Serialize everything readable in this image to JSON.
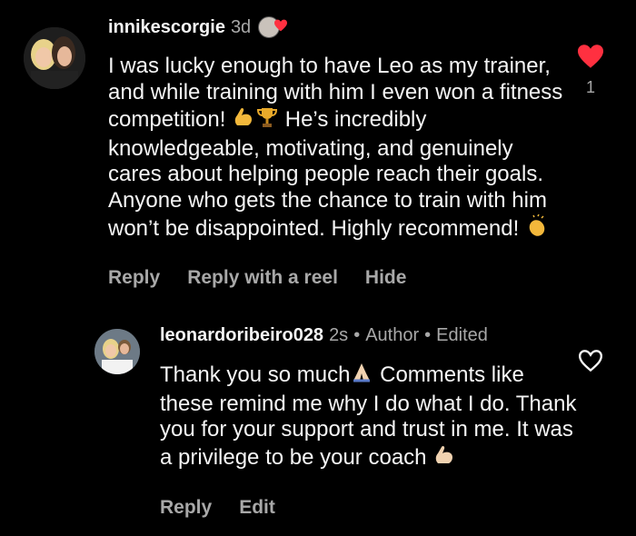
{
  "comments": [
    {
      "username": "innikescorgie",
      "time": "3d",
      "text_parts": [
        "I was lucky enough to have Leo as my trainer, and while training with him I even won a fitness competition! ",
        " He’s incredibly knowledgeable, motivating, and genuinely cares about helping people reach their goals. Anyone who gets the chance to train with him won’t be disappointed. Highly recommend! "
      ],
      "emojis": [
        "flexed-biceps",
        "trophy",
        "clapping-hands"
      ],
      "actions": [
        "Reply",
        "Reply with a reel",
        "Hide"
      ],
      "liked": true,
      "like_count": "1",
      "author_liked": true
    },
    {
      "username": "leonardoribeiro028",
      "time": "2s",
      "author_label": "Author",
      "edited_label": "Edited",
      "text_parts": [
        "Thank you so much",
        " Comments like these remind me why I do what I do. Thank you for your support and trust in me. It was a privilege to be your coach "
      ],
      "emojis": [
        "folded-hands",
        "flexed-biceps"
      ],
      "actions": [
        "Reply",
        "Edit"
      ],
      "liked": false
    }
  ],
  "colors": {
    "background": "#000000",
    "text": "#f5f5f5",
    "secondary": "#a8a8a8",
    "like_red": "#ff3040"
  }
}
